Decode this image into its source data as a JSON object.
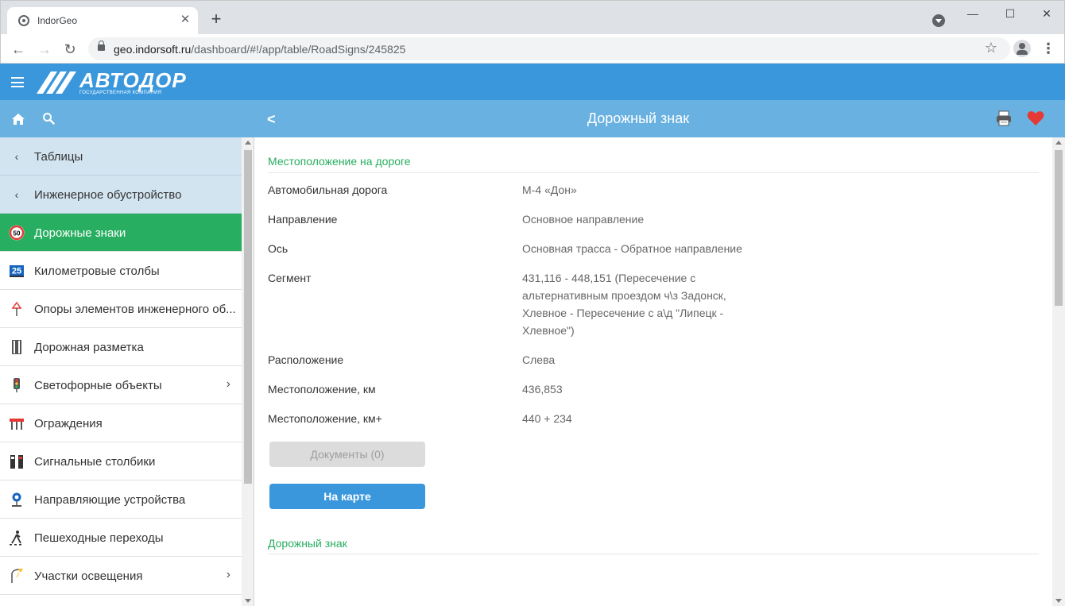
{
  "browser": {
    "tab_title": "IndorGeo",
    "tab_close": "✕",
    "new_tab": "+",
    "url_host": "geo.indorsoft.ru",
    "url_path": "/dashboard/#!/app/table/RoadSigns/245825",
    "window_min": "—",
    "window_max": "☐",
    "window_close": "✕",
    "back": "←",
    "forward": "→",
    "reload": "↻",
    "star": "☆",
    "menu": "⋮"
  },
  "app": {
    "logo_title": "АВТОДОР",
    "logo_subtitle": "ГОСУДАРСТВЕННАЯ КОМПАНИЯ",
    "page_title": "Дорожный знак",
    "back": "<"
  },
  "sidebar": {
    "items": [
      {
        "label": "Таблицы",
        "icon": "chevron-left-icon",
        "type": "nav"
      },
      {
        "label": "Инженерное обустройство",
        "icon": "chevron-left-icon",
        "type": "nav"
      },
      {
        "label": "Дорожные знаки",
        "icon": "speed-limit-sign-icon",
        "type": "active",
        "icon_text": "50"
      },
      {
        "label": "Километровые столбы",
        "icon": "kilometer-post-icon",
        "type": "item",
        "icon_text": "25"
      },
      {
        "label": "Опоры элементов инженерного об...",
        "icon": "support-pole-icon",
        "type": "item"
      },
      {
        "label": "Дорожная разметка",
        "icon": "road-marking-icon",
        "type": "item"
      },
      {
        "label": "Светофорные объекты",
        "icon": "traffic-light-icon",
        "type": "item",
        "has_children": true
      },
      {
        "label": "Ограждения",
        "icon": "barrier-icon",
        "type": "item"
      },
      {
        "label": "Сигнальные столбики",
        "icon": "signal-post-icon",
        "type": "item"
      },
      {
        "label": "Направляющие устройства",
        "icon": "guide-device-icon",
        "type": "item"
      },
      {
        "label": "Пешеходные переходы",
        "icon": "pedestrian-crossing-icon",
        "type": "item"
      },
      {
        "label": "Участки освещения",
        "icon": "lighting-icon",
        "type": "item",
        "has_children": true
      }
    ],
    "chevron": "›"
  },
  "main": {
    "section_location": "Местоположение на дороге",
    "fields": [
      {
        "label": "Автомобильная дорога",
        "value": "М-4 «Дон»"
      },
      {
        "label": "Направление",
        "value": "Основное направление"
      },
      {
        "label": "Ось",
        "value": "Основная трасса - Обратное направление"
      },
      {
        "label": "Сегмент",
        "value": "431,116 - 448,151 (Пересечение с альтернативным проездом ч\\з Задонск, Хлевное - Пересечение с а\\д \"Липецк - Хлевное\")"
      },
      {
        "label": "Расположение",
        "value": "Слева"
      },
      {
        "label": "Местоположение, км",
        "value": "436,853"
      },
      {
        "label": "Местоположение, км+",
        "value": "440 + 234"
      }
    ],
    "documents_button": "Документы (0)",
    "map_button": "На карте",
    "section_sign": "Дорожный знак"
  },
  "colors": {
    "header": "#3a97dc",
    "subheader": "#69b1e1",
    "active": "#27ae60",
    "section": "#27ae60",
    "heart": "#e53935"
  }
}
